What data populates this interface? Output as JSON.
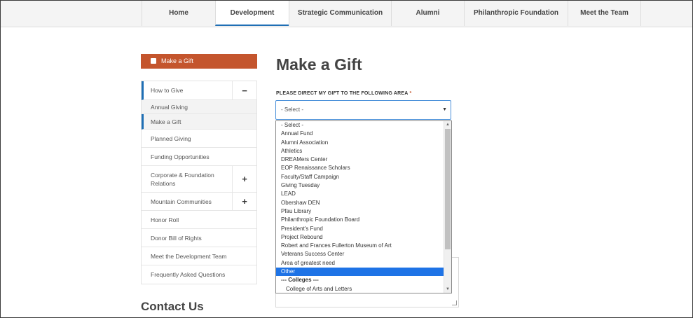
{
  "nav": {
    "items": [
      {
        "label": "Home",
        "active": false
      },
      {
        "label": "Development",
        "active": true
      },
      {
        "label": "Strategic Communication",
        "active": false
      },
      {
        "label": "Alumni",
        "active": false
      },
      {
        "label": "Philanthropic Foundation",
        "active": false
      },
      {
        "label": "Meet the Team",
        "active": false
      }
    ]
  },
  "sidebar": {
    "gift_button": "Make a Gift",
    "items": [
      {
        "label": "How to Give",
        "toggle": "−"
      },
      {
        "label": "Annual Giving",
        "sub": true
      },
      {
        "label": "Make a Gift",
        "sub": true,
        "selected": true
      },
      {
        "label": "Planned Giving"
      },
      {
        "label": "Funding Opportunities"
      },
      {
        "label": "Corporate & Foundation Relations",
        "toggle": "+"
      },
      {
        "label": "Mountain Communities",
        "toggle": "+"
      },
      {
        "label": "Honor Roll"
      },
      {
        "label": "Donor Bill of Rights"
      },
      {
        "label": "Meet the Development Team"
      },
      {
        "label": "Frequently Asked Questions"
      }
    ],
    "contact_heading": "Contact Us"
  },
  "main": {
    "title": "Make a Gift",
    "field_label": "PLEASE DIRECT MY GIFT TO THE FOLLOWING AREA",
    "required_mark": "*",
    "select_value": "- Select -",
    "options": [
      {
        "label": "- Select -"
      },
      {
        "label": "Annual Fund"
      },
      {
        "label": "Alumni Association"
      },
      {
        "label": "Athletics"
      },
      {
        "label": "DREAMers Center"
      },
      {
        "label": "EOP Renaissance Scholars"
      },
      {
        "label": "Faculty/Staff Campaign"
      },
      {
        "label": "Giving Tuesday"
      },
      {
        "label": "LEAD"
      },
      {
        "label": "Obershaw DEN"
      },
      {
        "label": "Pfau Library"
      },
      {
        "label": "Philanthropic Foundation Board"
      },
      {
        "label": "President's Fund"
      },
      {
        "label": "Project Rebound"
      },
      {
        "label": "Robert and Frances Fullerton Museum of Art"
      },
      {
        "label": "Veterans Success Center"
      },
      {
        "label": "Area of greatest need"
      },
      {
        "label": "Other",
        "highlighted": true
      },
      {
        "label": "--- Colleges ---",
        "group": true
      },
      {
        "label": "College of Arts and Letters",
        "child": true
      }
    ]
  },
  "colors": {
    "accent_orange": "#c4552d",
    "active_blue": "#1f6fb5",
    "highlight_blue": "#1e73e6"
  }
}
